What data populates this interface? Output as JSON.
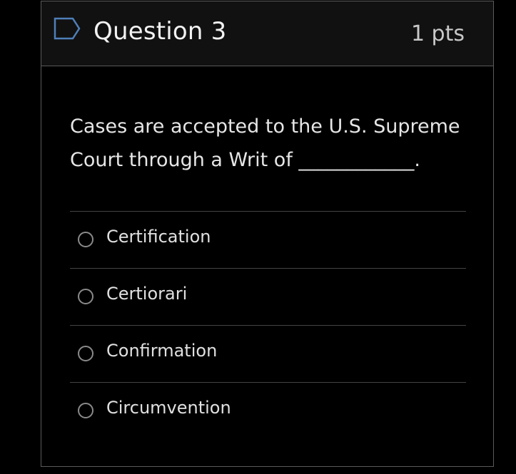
{
  "question": {
    "title": "Question 3",
    "points": "1 pts",
    "text": "Cases are accepted to the U.S. Supreme Court through a Writ of ____________.",
    "flag_icon": "flag-outline-icon"
  },
  "answers": [
    {
      "label": "Certification",
      "selected": false
    },
    {
      "label": "Certiorari",
      "selected": false
    },
    {
      "label": "Confirmation",
      "selected": false
    },
    {
      "label": "Circumvention",
      "selected": false
    }
  ],
  "colors": {
    "background": "#000000",
    "header_background": "#111111",
    "border": "#5a5a5a",
    "text": "#e6e6e6",
    "muted": "#c8c8c8"
  }
}
